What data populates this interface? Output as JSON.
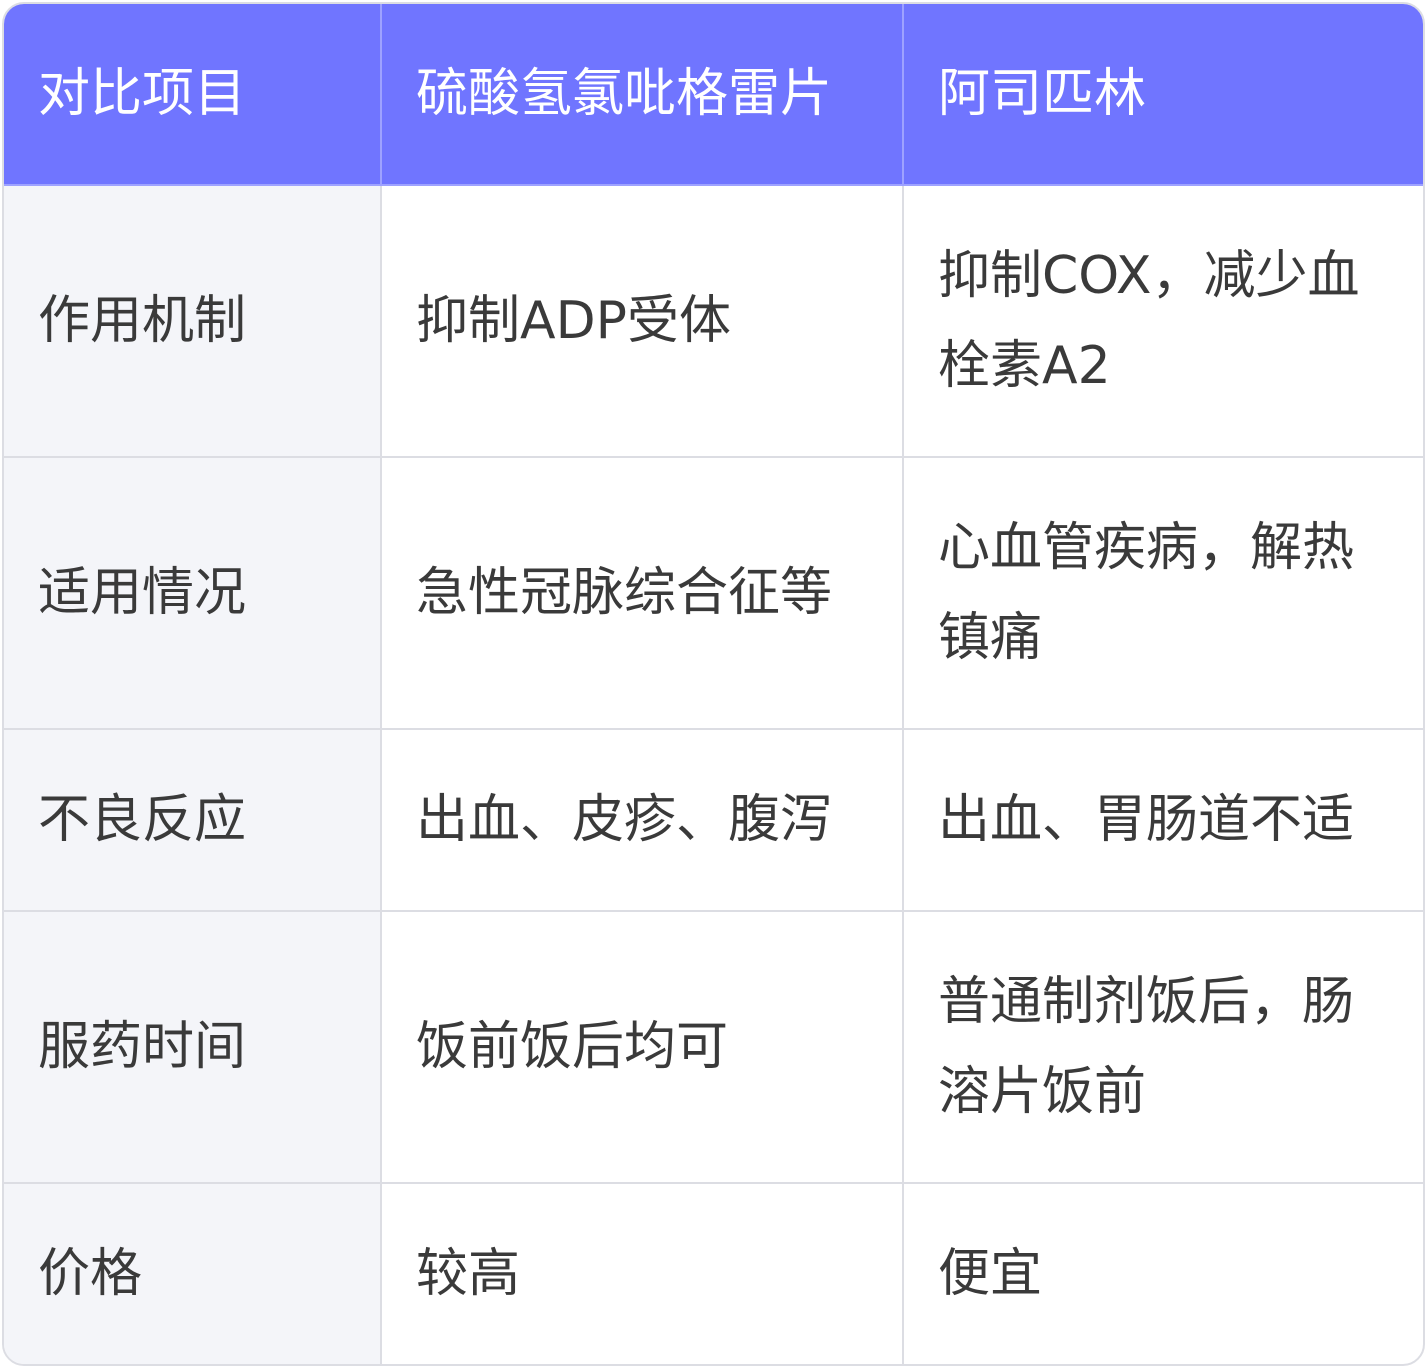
{
  "header": {
    "col1": "对比项目",
    "col2": "硫酸氢氯吡格雷片",
    "col3": "阿司匹林"
  },
  "rows": [
    {
      "label": "作用机制",
      "clopidogrel": "抑制ADP受体",
      "aspirin": "抑制COX，减少血栓素A2"
    },
    {
      "label": "适用情况",
      "clopidogrel": "急性冠脉综合征等",
      "aspirin": "心血管疾病，解热镇痛"
    },
    {
      "label": "不良反应",
      "clopidogrel": "出血、皮疹、腹泻",
      "aspirin": "出血、胃肠道不适"
    },
    {
      "label": "服药时间",
      "clopidogrel": "饭前饭后均可",
      "aspirin": "普通制剂饭后，肠溶片饭前"
    },
    {
      "label": "价格",
      "clopidogrel": "较高",
      "aspirin": "便宜"
    }
  ],
  "colors": {
    "header_bg": "#7075ff",
    "label_bg": "#f4f5f9",
    "border": "#dcdde3",
    "text": "#3a3a3a"
  }
}
